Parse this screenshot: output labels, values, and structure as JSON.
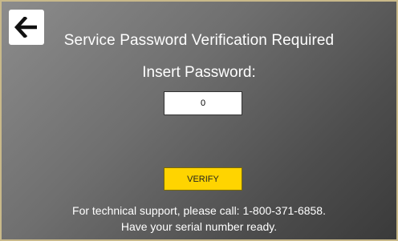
{
  "header": {
    "back_icon": "arrow-left-icon",
    "title": "Service Password Verification Required"
  },
  "form": {
    "prompt": "Insert Password:",
    "password_value": "0",
    "verify_label": "VERIFY"
  },
  "footer": {
    "support_line_1": "For technical support, please call: 1-800-371-6858.",
    "support_line_2": "Have your serial number ready."
  },
  "colors": {
    "accent_button": "#ffd400",
    "frame_border": "#c9b98a",
    "background_light": "#8c8c8c",
    "background_dark": "#3a3a3a"
  }
}
